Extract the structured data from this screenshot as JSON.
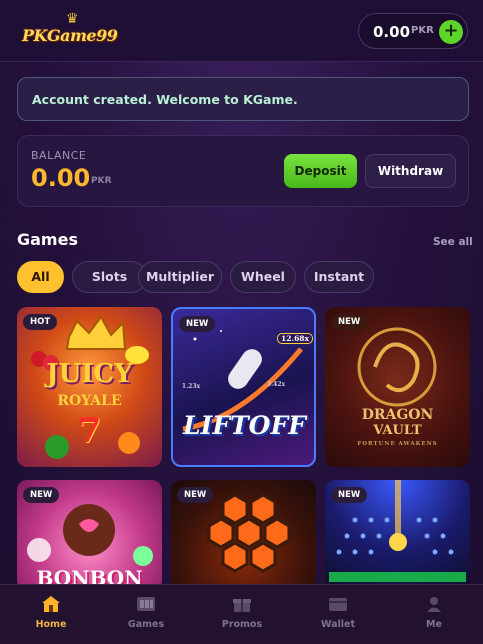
{
  "header": {
    "logo_text": "PKGame99",
    "wallet": {
      "amount": "0.00",
      "currency": "PKR"
    }
  },
  "notice": {
    "text": "Account created. Welcome to KGame."
  },
  "balance": {
    "label": "BALANCE",
    "amount": "0.00",
    "currency": "PKR",
    "deposit_label": "Deposit",
    "withdraw_label": "Withdraw"
  },
  "games": {
    "title": "Games",
    "see_all": "See all",
    "filters": [
      "All",
      "Slots",
      "Multiplier",
      "Wheel",
      "Instant"
    ],
    "active_filter": "All",
    "tiles": [
      {
        "badge": "HOT",
        "art_line1": "JUICY",
        "art_line2": "ROYALE",
        "art_line3": "7"
      },
      {
        "badge": "NEW",
        "art_line1": "LIFTOFF",
        "art_line2": "12.68x",
        "art_line3": "3.42x",
        "art_line4": "1.23x"
      },
      {
        "badge": "NEW",
        "art_line1": "DRAGON",
        "art_line2": "VAULT",
        "art_line3": "FORTUNE AWAKENS"
      },
      {
        "badge": "NEW",
        "art_line1": "BONBON"
      },
      {
        "badge": "NEW"
      },
      {
        "badge": "NEW"
      }
    ]
  },
  "nav": {
    "items": [
      {
        "label": "Home",
        "icon": "home-icon"
      },
      {
        "label": "Games",
        "icon": "games-icon"
      },
      {
        "label": "Promos",
        "icon": "gift-icon"
      },
      {
        "label": "Wallet",
        "icon": "wallet-icon"
      },
      {
        "label": "Me",
        "icon": "user-icon"
      }
    ],
    "active": "Home"
  },
  "colors": {
    "accent": "#ffc12e",
    "deposit_green": "#5dd42a",
    "balance_amount": "#ffb82e",
    "background": "#24113c"
  }
}
